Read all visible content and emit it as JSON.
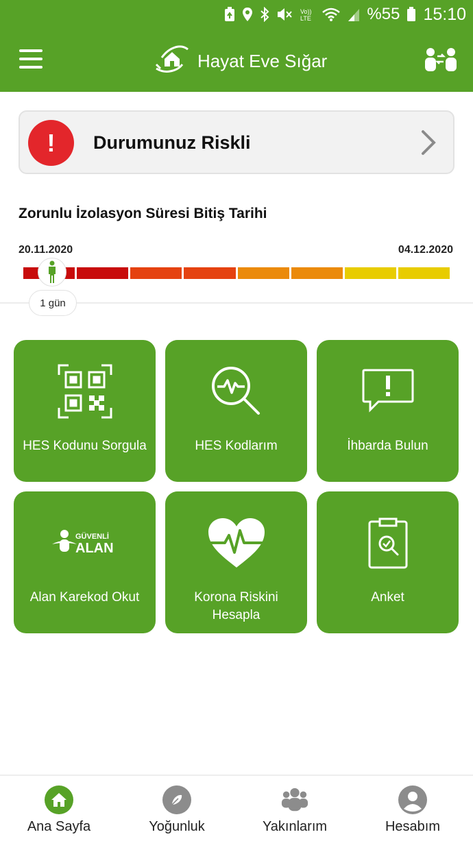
{
  "status_bar": {
    "battery_percent": "%55",
    "time": "15:10",
    "icons": [
      "battery-saver-icon",
      "location-icon",
      "bluetooth-icon",
      "mute-icon",
      "volte-icon",
      "wifi-icon",
      "signal-icon",
      "battery-icon"
    ],
    "volte_label": "Vo)) LTE"
  },
  "app_bar": {
    "title": "Hayat Eve Sığar",
    "menu_icon": "hamburger-menu-icon",
    "logo_icon": "hands-house-icon",
    "right_icon": "contacts-exchange-icon"
  },
  "risk": {
    "text": "Durumunuz Riskli",
    "icon": "exclamation-icon",
    "badge_color": "#e3262b"
  },
  "isolation": {
    "title": "Zorunlu İzolasyon Süresi Bitiş Tarihi",
    "start_date": "20.11.2020",
    "end_date": "04.12.2020",
    "days_label": "1 gün",
    "segment_colors": [
      "#c80b0b",
      "#c80b0b",
      "#e54210",
      "#e54210",
      "#eb8a0a",
      "#eb8a0a",
      "#e8cc00",
      "#e8cc00"
    ]
  },
  "tiles": [
    {
      "label": "HES Kodunu Sorgula",
      "icon": "qr-code-icon"
    },
    {
      "label": "HES Kodlarım",
      "icon": "search-pulse-icon"
    },
    {
      "label": "İhbarda Bulun",
      "icon": "alert-message-icon"
    },
    {
      "label": "Alan Karekod Okut",
      "icon": "guvenli-alan-icon",
      "logo_text_top": "GÜVENLİ",
      "logo_text_bottom": "ALAN"
    },
    {
      "label": "Korona Riskini\nHesapla",
      "icon": "heart-pulse-icon"
    },
    {
      "label": "Anket",
      "icon": "clipboard-search-icon"
    }
  ],
  "bottom_nav": [
    {
      "label": "Ana Sayfa",
      "icon": "home-icon",
      "active": true
    },
    {
      "label": "Yoğunluk",
      "icon": "compass-icon",
      "active": false
    },
    {
      "label": "Yakınlarım",
      "icon": "people-icon",
      "active": false
    },
    {
      "label": "Hesabım",
      "icon": "profile-icon",
      "active": false
    }
  ],
  "colors": {
    "brand_green": "#57a227",
    "inactive_icon": "#8c8c8c"
  }
}
